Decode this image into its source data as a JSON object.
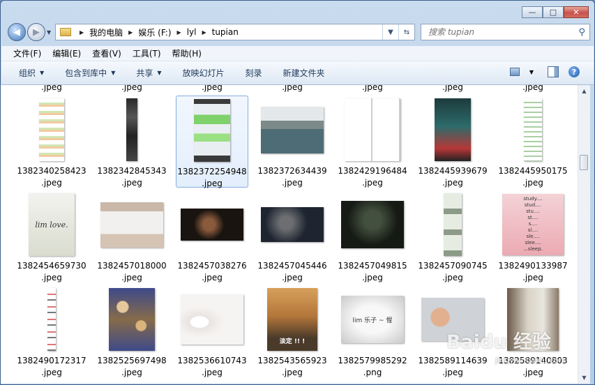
{
  "window": {
    "caption": {
      "minimize": "—",
      "maximize": "□",
      "close": "✕"
    }
  },
  "nav": {
    "breadcrumbs": [
      "我的电脑",
      "娱乐 (F:)",
      "lyl",
      "tupian"
    ],
    "search_placeholder": "搜索 tupian"
  },
  "menu": [
    "文件(F)",
    "编辑(E)",
    "查看(V)",
    "工具(T)",
    "帮助(H)"
  ],
  "toolbar": {
    "organize": "组织",
    "include": "包含到库中",
    "share": "共享",
    "slideshow": "放映幻灯片",
    "burn": "刻录",
    "new_folder": "新建文件夹"
  },
  "top_row_names": [
    ".jpeg",
    ".jpeg",
    ".jpeg",
    ".jpeg",
    ".jpeg",
    ".jpeg",
    ".jpeg"
  ],
  "files": [
    {
      "num": "1382340258423",
      "ext": ".jpeg"
    },
    {
      "num": "1382342845343",
      "ext": ".jpeg"
    },
    {
      "num": "1382372254948",
      "ext": ".jpeg"
    },
    {
      "num": "1382372634439",
      "ext": ".jpeg"
    },
    {
      "num": "1382429196484",
      "ext": ".jpeg"
    },
    {
      "num": "1382445939679",
      "ext": ".jpeg"
    },
    {
      "num": "1382445950175",
      "ext": ".jpeg"
    },
    {
      "num": "1382454659730",
      "ext": ".jpeg"
    },
    {
      "num": "1382457018000",
      "ext": ".jpeg"
    },
    {
      "num": "1382457038276",
      "ext": ".jpeg"
    },
    {
      "num": "1382457045446",
      "ext": ".jpeg"
    },
    {
      "num": "1382457049815",
      "ext": ".jpeg"
    },
    {
      "num": "1382457090745",
      "ext": ".jpeg"
    },
    {
      "num": "1382490133987",
      "ext": ".jpeg"
    },
    {
      "num": "1382490172317",
      "ext": ".jpeg"
    },
    {
      "num": "1382525697498",
      "ext": ".jpeg"
    },
    {
      "num": "1382536610743",
      "ext": ".jpeg"
    },
    {
      "num": "1382543565923",
      "ext": ".jpeg"
    },
    {
      "num": "1382579985292",
      "ext": ".png"
    },
    {
      "num": "1382589114639",
      "ext": ".jpeg"
    },
    {
      "num": "1382589140803",
      "ext": ".jpeg"
    }
  ],
  "thumb_text": {
    "lim_love": "lim love.",
    "study": "study....\nstud....\nstu....\nst....\ns....\nsl....\nsle....\nslee....\n...sleep.",
    "dog_caption": "淡定 !! !",
    "png_text": "lim 乐子 ~ 惺"
  },
  "watermark": {
    "brand": "Baidu 经验",
    "url": "jingyan.baidu.com"
  },
  "selected_file": "1382372254948"
}
